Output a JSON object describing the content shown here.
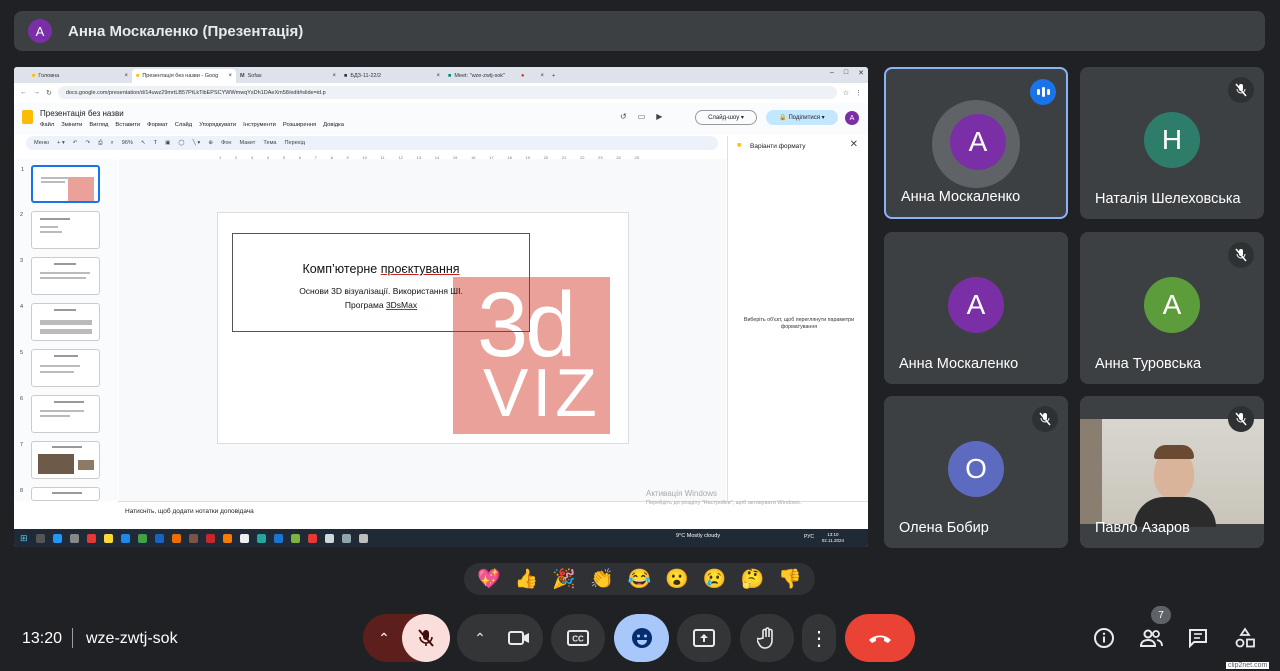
{
  "presenter_bar": {
    "avatar_letter": "A",
    "title": "Анна Москаленко (Презентація)"
  },
  "browser": {
    "tabs": [
      {
        "label": "Головна"
      },
      {
        "label": "Презентація без назви - Goog"
      },
      {
        "label": "Sofas"
      },
      {
        "label": "БДЗ-11-22/2"
      },
      {
        "label": "Meet: \"wze-zwtj-sok\""
      }
    ],
    "url": "docs.google.com/presentation/d/14uwz29mrtLB57PtLkTibEPSCYWWmwqYsDh1DAeXm58/edit#slide=id.p"
  },
  "slides_app": {
    "doc_title": "Презентація без назви",
    "menus": [
      "Файл",
      "Змінити",
      "Вигляд",
      "Вставити",
      "Формат",
      "Слайд",
      "Упорядкувати",
      "Інструменти",
      "Розширення",
      "Довідка"
    ],
    "slideshow_label": "Слайд-шоу",
    "share_label": "Поділитися",
    "user_letter": "A",
    "toolbar": {
      "search": "Меню",
      "zoom": "96%",
      "bg": "Фон",
      "layout": "Макет",
      "theme": "Тема",
      "transition": "Перехід"
    },
    "slide_numbers": [
      "1",
      "2",
      "3",
      "4",
      "5",
      "6",
      "7",
      "8"
    ],
    "slide": {
      "title_prefix": "Комп’ютерне ",
      "title_link": "проєктування",
      "subtitle_line1": "Основи 3D візуалізації. Використання ШІ.",
      "subtitle_line2_prefix": "Програма ",
      "subtitle_line2_link": "3DsMax",
      "logo_line1": "3d",
      "logo_line2": "VIZ"
    },
    "side_panel": {
      "title": "Варіанти формату",
      "hint": "Виберіть об'єкт, щоб переглянути параметри форматування"
    },
    "notes_placeholder": "Натисніть, щоб додати нотатки доповідача",
    "activate_title": "Активація Windows",
    "activate_text": "Перейдіть до розділу \"Настройки\", щоб активувати Windows.",
    "ruler": [
      "1",
      "2",
      "3",
      "4",
      "5",
      "6",
      "7",
      "8",
      "9",
      "10",
      "11",
      "12",
      "13",
      "14",
      "15",
      "16",
      "17",
      "18",
      "19",
      "20",
      "21",
      "22",
      "23",
      "24",
      "25"
    ],
    "taskbar": {
      "weather": "9°C  Mostly cloudy",
      "lang": "РУС",
      "time": "13:10",
      "date": "02.11.2024"
    }
  },
  "participants": [
    {
      "letter": "A",
      "name": "Анна Москаленко",
      "color": "#7b2fa6",
      "speaking": true
    },
    {
      "letter": "Н",
      "name": "Наталія Шелеховська",
      "color": "#2e7d6b",
      "muted": true
    },
    {
      "letter": "A",
      "name": "Анна Москаленко",
      "color": "#7b2fa6"
    },
    {
      "letter": "A",
      "name": "Анна Туровська",
      "color": "#5d9c3b",
      "muted": true
    },
    {
      "letter": "О",
      "name": "Олена Бобир",
      "color": "#5c6bc0",
      "muted": true
    },
    {
      "letter": "",
      "name": "Павло Азаров",
      "muted": true,
      "camera_on": true
    }
  ],
  "reactions": [
    "💖",
    "👍",
    "🎉",
    "👏",
    "😂",
    "😮",
    "😢",
    "🤔",
    "👎"
  ],
  "bottom_bar": {
    "time": "13:20",
    "meeting_code": "wze-zwtj-sok",
    "participant_count": "7"
  },
  "watermark": "clip2net.com",
  "colors": {
    "leave": "#ea4335",
    "mic_off": "#f9dedc",
    "active": "#a8c7fa"
  }
}
